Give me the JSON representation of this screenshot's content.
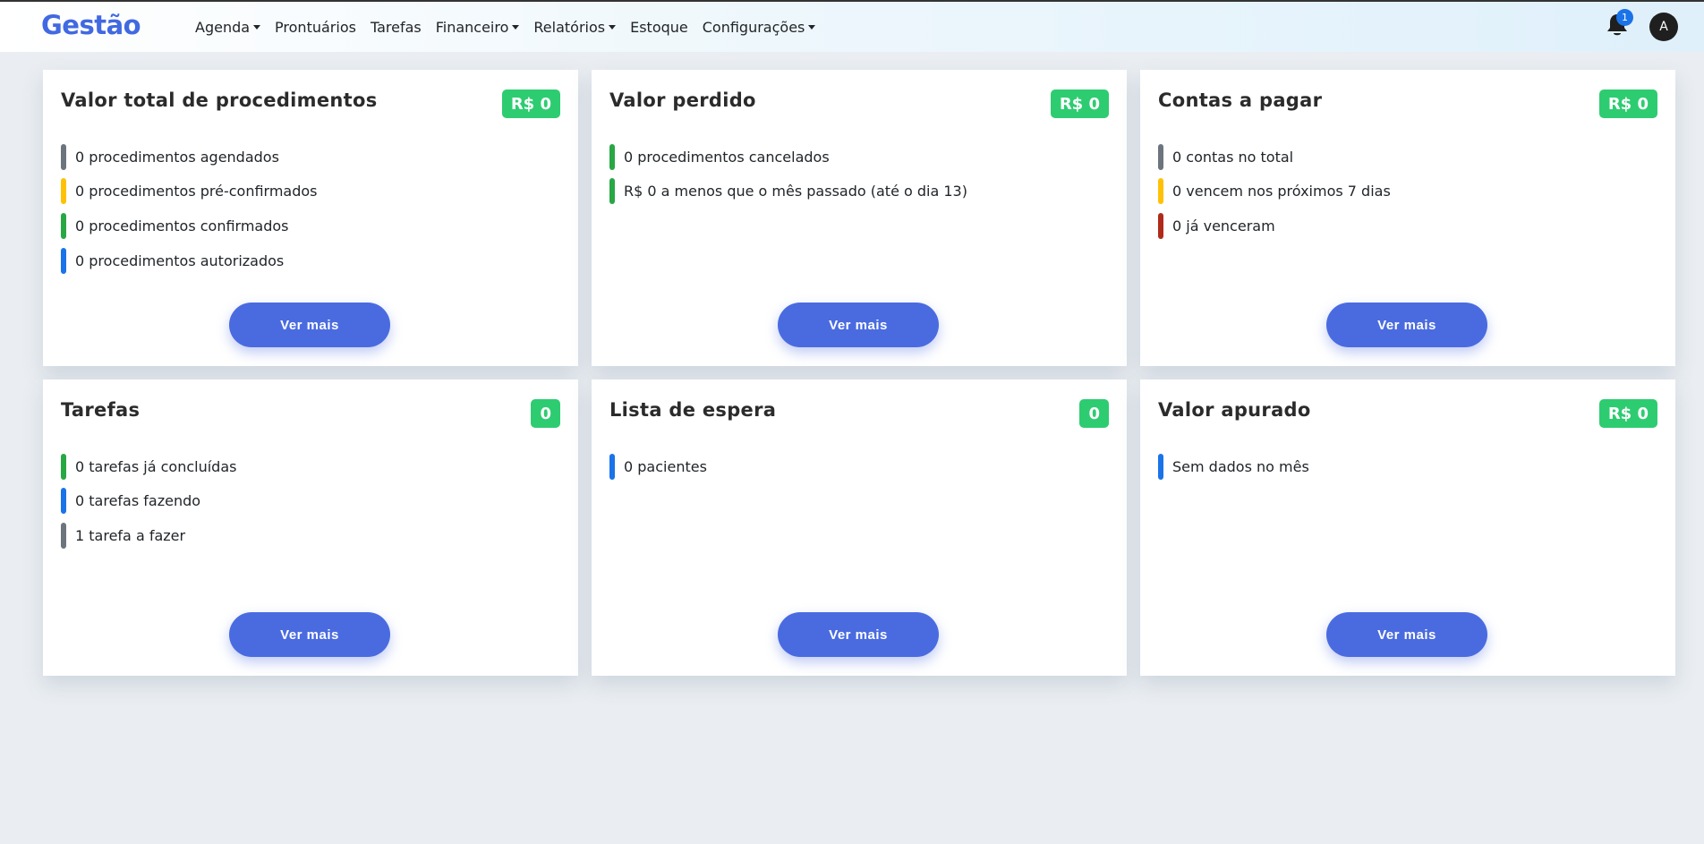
{
  "brand": "Gestão",
  "nav": [
    {
      "label": "Agenda",
      "dropdown": true
    },
    {
      "label": "Prontuários",
      "dropdown": false
    },
    {
      "label": "Tarefas",
      "dropdown": false
    },
    {
      "label": "Financeiro",
      "dropdown": true
    },
    {
      "label": "Relatórios",
      "dropdown": true
    },
    {
      "label": "Estoque",
      "dropdown": false
    },
    {
      "label": "Configurações",
      "dropdown": true
    }
  ],
  "notifications": {
    "count": "1",
    "icon": "bell-icon"
  },
  "user": {
    "avatar_initial": "A"
  },
  "colors": {
    "accent": "#4a6be0",
    "badge": "#2ecc71",
    "gray": "#6c757d",
    "yellow": "#ffc107",
    "green": "#28a745",
    "blue": "#1a73e8",
    "red": "#b02a1a"
  },
  "cards": [
    {
      "title": "Valor total de procedimentos",
      "badge": "R$ 0",
      "button": "Ver mais",
      "items": [
        {
          "text": "0 procedimentos agendados",
          "color": "gray"
        },
        {
          "text": "0 procedimentos pré-confirmados",
          "color": "yellow"
        },
        {
          "text": "0 procedimentos confirmados",
          "color": "green"
        },
        {
          "text": "0 procedimentos autorizados",
          "color": "blue"
        }
      ]
    },
    {
      "title": "Valor perdido",
      "badge": "R$ 0",
      "button": "Ver mais",
      "items": [
        {
          "text": "0 procedimentos cancelados",
          "color": "green"
        },
        {
          "text": "R$ 0 a menos que o mês passado (até o dia 13)",
          "color": "green"
        }
      ]
    },
    {
      "title": "Contas a pagar",
      "badge": "R$ 0",
      "button": "Ver mais",
      "items": [
        {
          "text": "0 contas no total",
          "color": "gray"
        },
        {
          "text": "0 vencem nos próximos 7 dias",
          "color": "yellow"
        },
        {
          "text": "0 já venceram",
          "color": "red"
        }
      ]
    },
    {
      "title": "Tarefas",
      "badge": "0",
      "button": "Ver mais",
      "items": [
        {
          "text": "0 tarefas já concluídas",
          "color": "green"
        },
        {
          "text": "0 tarefas fazendo",
          "color": "blue"
        },
        {
          "text": "1 tarefa a fazer",
          "color": "gray"
        }
      ]
    },
    {
      "title": "Lista de espera",
      "badge": "0",
      "button": "Ver mais",
      "items": [
        {
          "text": "0 pacientes",
          "color": "blue"
        }
      ]
    },
    {
      "title": "Valor apurado",
      "badge": "R$ 0",
      "button": "Ver mais",
      "items": [
        {
          "text": "Sem dados no mês",
          "color": "blue"
        }
      ]
    }
  ]
}
